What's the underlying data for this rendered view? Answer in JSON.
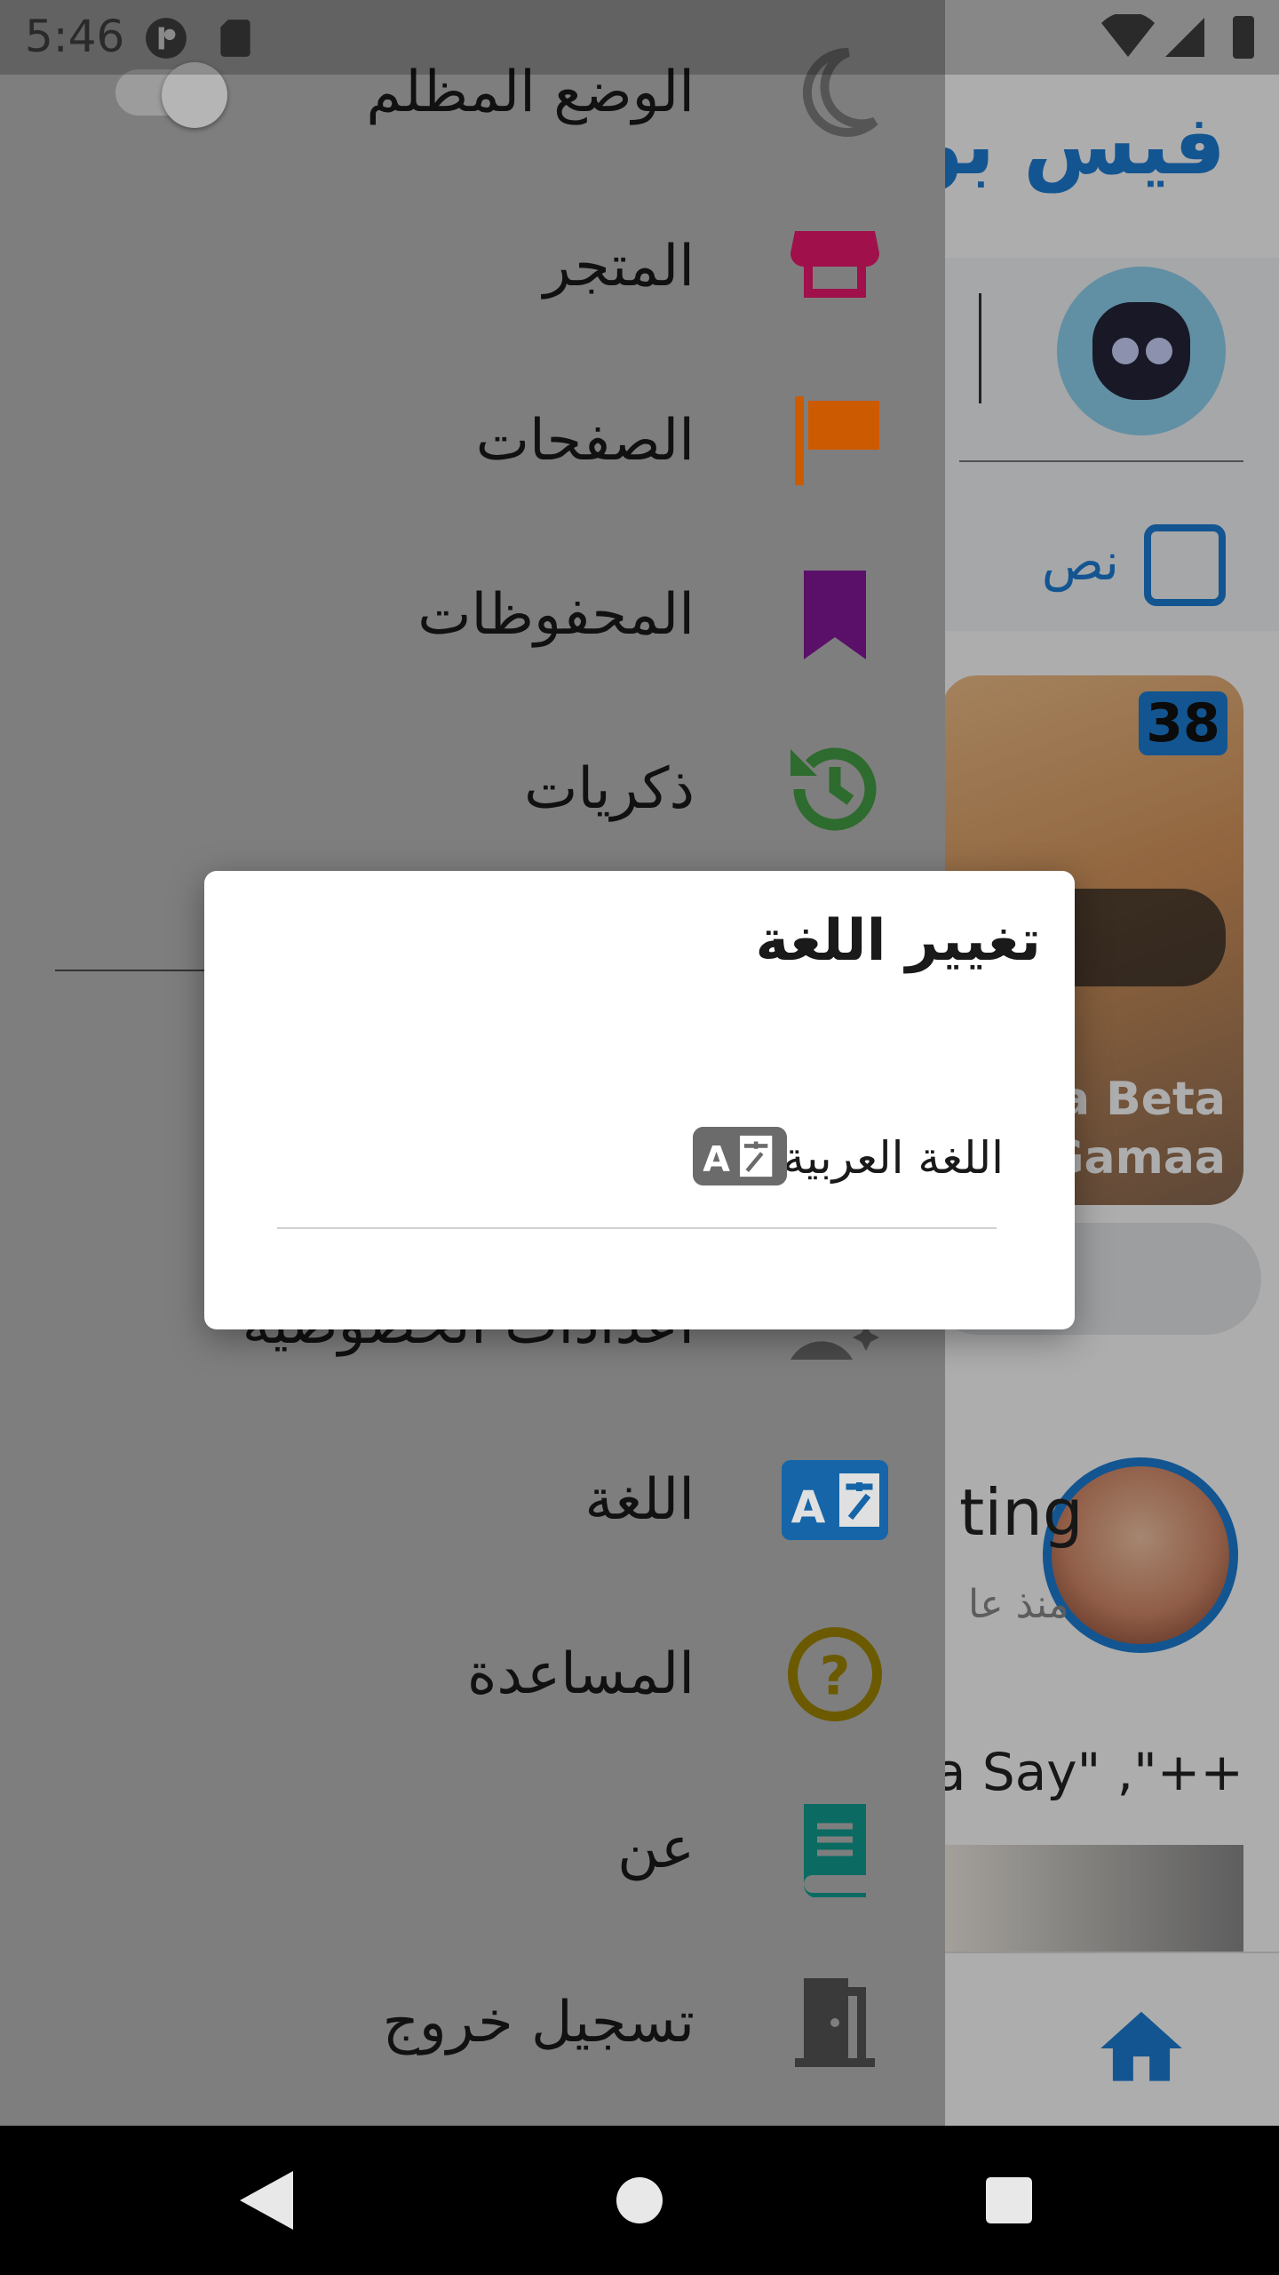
{
  "status_bar": {
    "time": "5:46"
  },
  "background_app": {
    "title": "فيس بوك",
    "composer_hint": "نص",
    "story_badge": "38",
    "story_name": "fa Beta\nGamaa",
    "post_author": "ting",
    "post_time": "منذ عا",
    "post_text": "Java Say\" ,\"++"
  },
  "drawer": {
    "items": [
      {
        "label": "الوضع المظلم",
        "icon": "moon-icon",
        "color": "#555555"
      },
      {
        "label": "المتجر",
        "icon": "store-icon",
        "color": "#a0104a"
      },
      {
        "label": "الصفحات",
        "icon": "flag-icon",
        "color": "#cc5a00"
      },
      {
        "label": "المحفوظات",
        "icon": "bookmark-icon",
        "color": "#5a1068"
      },
      {
        "label": "ذكريات",
        "icon": "history-icon",
        "color": "#2e6b2e"
      },
      {
        "label": "اعدادات الخصوصية",
        "icon": "privacy-settings-icon",
        "color": "#4a4a4a"
      },
      {
        "label": "اللغة",
        "icon": "translate-icon",
        "color": "#1565a8"
      },
      {
        "label": "المساعدة",
        "icon": "help-icon",
        "color": "#6b5a00"
      },
      {
        "label": "عن",
        "icon": "book-icon",
        "color": "#0b6b62"
      },
      {
        "label": "تسجيل خروج",
        "icon": "logout-door-icon",
        "color": "#3a3a3a"
      }
    ]
  },
  "dialog": {
    "title": "تغيير اللغة",
    "option_label": "اللغة العربية",
    "option_icon": "translate-icon"
  },
  "colors": {
    "accent": "#1c7ed6",
    "drawer_bg": "#7e7e7e"
  }
}
